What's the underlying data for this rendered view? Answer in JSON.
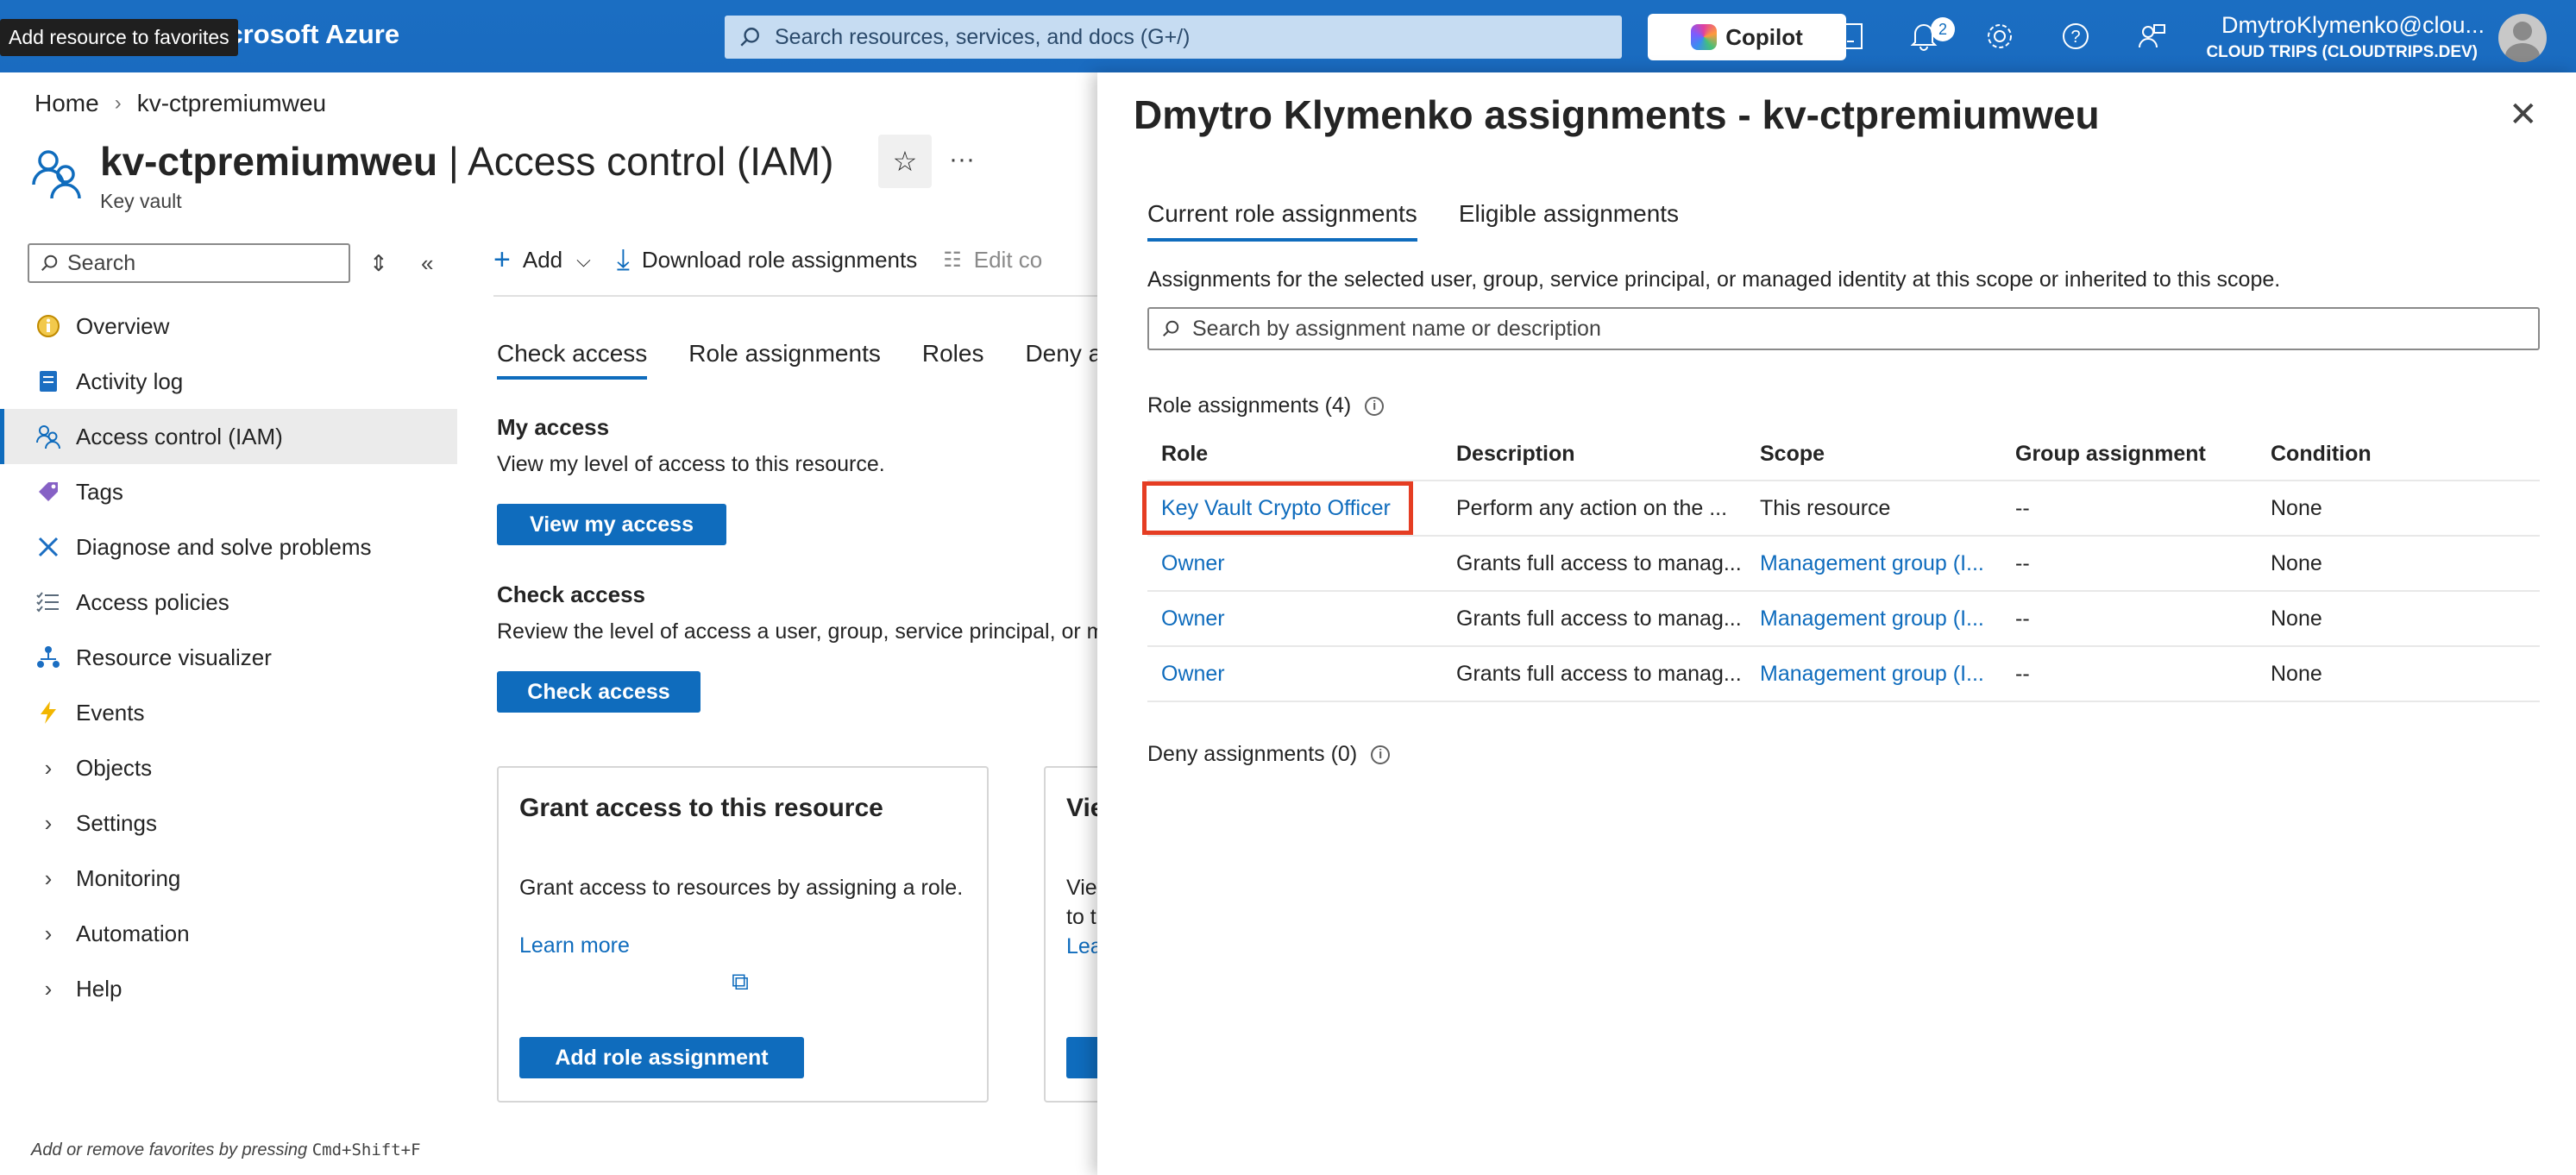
{
  "topbar": {
    "brand": "Microsoft Azure",
    "tooltip": "Add resource to favorites",
    "search_placeholder": "Search resources, services, and docs (G+/)",
    "copilot_label": "Copilot",
    "notification_count": "2",
    "account_name": "DmytroKlymenko@clou...",
    "account_directory": "CLOUD TRIPS (CLOUDTRIPS.DEV)"
  },
  "breadcrumb": [
    "Home",
    "kv-ctpremiumweu"
  ],
  "page": {
    "resource_name": "kv-ctpremiumweu",
    "title_suffix": " | Access control (IAM)",
    "resource_type": "Key vault"
  },
  "sidebar": {
    "search_placeholder": "Search",
    "items": [
      {
        "label": "Overview",
        "icon": "overview-icon"
      },
      {
        "label": "Activity log",
        "icon": "activity-log-icon"
      },
      {
        "label": "Access control (IAM)",
        "icon": "iam-icon",
        "active": true
      },
      {
        "label": "Tags",
        "icon": "tag-icon"
      },
      {
        "label": "Diagnose and solve problems",
        "icon": "wrench-icon"
      },
      {
        "label": "Access policies",
        "icon": "policies-icon"
      },
      {
        "label": "Resource visualizer",
        "icon": "visualizer-icon"
      },
      {
        "label": "Events",
        "icon": "lightning-icon"
      },
      {
        "label": "Objects",
        "expandable": true
      },
      {
        "label": "Settings",
        "expandable": true
      },
      {
        "label": "Monitoring",
        "expandable": true
      },
      {
        "label": "Automation",
        "expandable": true
      },
      {
        "label": "Help",
        "expandable": true
      }
    ]
  },
  "toolbar": {
    "add": "Add",
    "download": "Download role assignments",
    "edit": "Edit co"
  },
  "tabs": [
    "Check access",
    "Role assignments",
    "Roles",
    "Deny ass"
  ],
  "check": {
    "my_access_heading": "My access",
    "my_access_text": "View my level of access to this resource.",
    "view_my_access": "View my access",
    "check_access_heading": "Check access",
    "check_access_text": "Review the level of access a user, group, service principal, or m",
    "check_access_button": "Check access"
  },
  "cards": {
    "grant_title": "Grant access to this resource",
    "grant_text": "Grant access to resources by assigning a role.",
    "learn_more": "Learn more",
    "add_role": "Add role assignment",
    "view_title": "Vie",
    "view_text1": "Viev",
    "view_text2": "to t",
    "view_learn": "Lea"
  },
  "footer_hint": "Add or remove favorites by pressing",
  "footer_keys": "Cmd+Shift+F",
  "panel": {
    "title": "Dmytro Klymenko assignments - kv-ctpremiumweu",
    "tabs": [
      "Current role assignments",
      "Eligible assignments"
    ],
    "description": "Assignments for the selected user, group, service principal, or managed identity at this scope or inherited to this scope.",
    "search_placeholder": "Search by assignment name or description",
    "role_count_label": "Role assignments (4)",
    "deny_count_label": "Deny assignments (0)",
    "columns": [
      "Role",
      "Description",
      "Scope",
      "Group assignment",
      "Condition"
    ],
    "rows": [
      {
        "role": "Key Vault Crypto Officer",
        "description": "Perform any action on the ...",
        "scope": "This resource",
        "group": "--",
        "condition": "None"
      },
      {
        "role": "Owner",
        "description": "Grants full access to manag...",
        "scope": "Management group (I...",
        "group": "--",
        "condition": "None"
      },
      {
        "role": "Owner",
        "description": "Grants full access to manag...",
        "scope": "Management group (I...",
        "group": "--",
        "condition": "None"
      },
      {
        "role": "Owner",
        "description": "Grants full access to manag...",
        "scope": "Management group (I...",
        "group": "--",
        "condition": "None"
      }
    ]
  },
  "colors": {
    "accent": "#0f6cbd",
    "highlight": "#e53d23"
  }
}
